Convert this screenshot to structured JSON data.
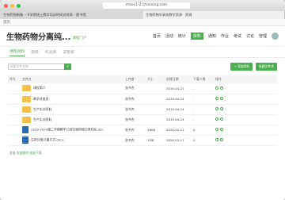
{
  "browser": {
    "url": "mooc1-2.chaoxing.com",
    "tabs": [
      "生物药物制备 -- 6学期线上教学培训时间安排表 - 图书馆",
      "生物药物学高效教学资源 · 资源"
    ]
  },
  "topbar": {
    "home": "首页"
  },
  "course": {
    "title": "生物药物分离纯...",
    "subtitle": "课程门户"
  },
  "nav": [
    "首页",
    "活动",
    "统计",
    "资料",
    "通知",
    "作业",
    "考试",
    "讨论",
    "管理"
  ],
  "nav_active_index": 3,
  "subtabs": [
    "课程资料",
    "题库",
    "作业库",
    "试卷库"
  ],
  "search": {
    "placeholder": "搜索文件名称"
  },
  "buttons": {
    "upload": "+ 添加资料",
    "new_folder": "新建文件夹"
  },
  "table": {
    "headers": [
      "序号",
      "文件名",
      "上传者",
      "大小",
      "创建日期",
      "下载人数",
      "操作"
    ],
    "rows": [
      {
        "name": "课程简介",
        "owner": "张书杰",
        "size": "",
        "date": "2019-04-22",
        "downloads": "-",
        "type": "folder"
      },
      {
        "name": "教学进度表",
        "owner": "张书杰",
        "size": "",
        "date": "2019-04-24",
        "downloads": "-",
        "type": "folder"
      },
      {
        "name": "生产实训资料",
        "owner": "张书杰",
        "size": "",
        "date": "2019-04-24",
        "downloads": "-",
        "type": "folder"
      },
      {
        "name": "生产实训资料",
        "owner": "张书杰",
        "size": "",
        "date": "2019-04-24",
        "downloads": "-",
        "type": "folder"
      },
      {
        "name": "2019-2020第二学期教学计划生物药物分离纯化.doc",
        "owner": "张书杰",
        "size": "56KB",
        "date": "2020-02-12",
        "downloads": "0",
        "type": "doc"
      },
      {
        "name": "生药分离计算方式.docx",
        "owner": "张书杰",
        "size": "1MB",
        "date": "2020-02-17",
        "downloads": "0",
        "type": "doc"
      }
    ]
  },
  "footer": {
    "prefix": "全选",
    "actions": [
      "批量删除",
      "批量下载"
    ]
  }
}
